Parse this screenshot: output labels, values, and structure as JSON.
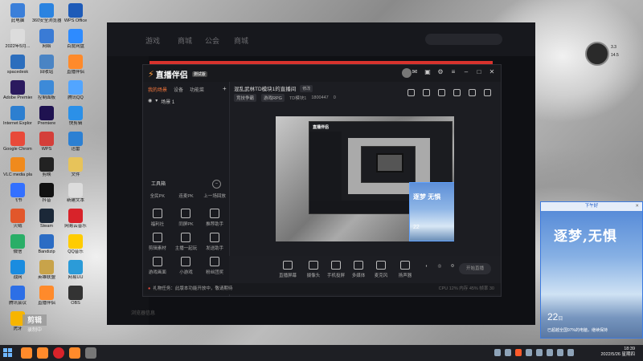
{
  "desktop": {
    "icons": [
      {
        "label": "此电脑",
        "color": "#3b7fd9"
      },
      {
        "label": "360安全浏览器",
        "color": "#2a83e0"
      },
      {
        "label": "WPS Office",
        "color": "#1e5bb8"
      },
      {
        "label": "2022年5月...",
        "color": "#dcdcdc"
      },
      {
        "label": "网络",
        "color": "#3a7bd5"
      },
      {
        "label": "百度网盘",
        "color": "#2e8bff"
      },
      {
        "label": "spacedesk",
        "color": "#2c6ebd"
      },
      {
        "label": "回收站",
        "color": "#4a84c4"
      },
      {
        "label": "直播伴侣",
        "color": "#ff8a2b"
      },
      {
        "label": "Adobe Premiere",
        "color": "#2b1a5e"
      },
      {
        "label": "控制面板",
        "color": "#3d8ad8"
      },
      {
        "label": "腾讯QQ",
        "color": "#52a5ff"
      },
      {
        "label": "Internet Explorer",
        "color": "#2d7fd0"
      },
      {
        "label": "Premiere",
        "color": "#1f1250"
      },
      {
        "label": "快剪辑",
        "color": "#2b90e8"
      },
      {
        "label": "Google Chrome",
        "color": "#e84a3a"
      },
      {
        "label": "WPS",
        "color": "#d43f3a"
      },
      {
        "label": "迅雷",
        "color": "#2c80d3"
      },
      {
        "label": "VLC media player",
        "color": "#f08a1c"
      },
      {
        "label": "剪映",
        "color": "#222"
      },
      {
        "label": "文件",
        "color": "#e7c35a"
      },
      {
        "label": "飞书",
        "color": "#3370ff"
      },
      {
        "label": "抖音",
        "color": "#111"
      },
      {
        "label": "新建文本",
        "color": "#dcdcdc"
      },
      {
        "label": "火绒",
        "color": "#e2572b"
      },
      {
        "label": "Steam",
        "color": "#1b2838"
      },
      {
        "label": "网易云音乐",
        "color": "#d8232a"
      },
      {
        "label": "微信",
        "color": "#2aae67"
      },
      {
        "label": "Bandizip",
        "color": "#2b6cc4"
      },
      {
        "label": "QQ音乐",
        "color": "#ffcc00"
      },
      {
        "label": "战网",
        "color": "#1a8ce0"
      },
      {
        "label": "英雄联盟",
        "color": "#c8a34a"
      },
      {
        "label": "网易UU",
        "color": "#2b9bd8"
      },
      {
        "label": "腾讯会议",
        "color": "#2d6fe6"
      },
      {
        "label": "直播伴侣",
        "color": "#ff8a2b"
      },
      {
        "label": "OBS",
        "color": "#333"
      },
      {
        "label": "虎牙",
        "color": "#f7b500"
      }
    ]
  },
  "bg_app": {
    "tabs": [
      "游戏",
      "商城",
      "公会",
      "商城"
    ],
    "footer": "浏览器信息"
  },
  "window": {
    "app_name": "直播伴侣",
    "app_badge": "测试版",
    "left_tabs": [
      "我的场景",
      "设备",
      "功能菜"
    ],
    "add_label": "+",
    "scene_label": "场景 1",
    "tools_title": "工具箱",
    "tool_rows": [
      [
        "全民PK",
        "连麦PK",
        "上一场回放"
      ],
      [
        "福利社",
        "同屏PK",
        "推荐助手"
      ],
      [
        "剪辑素材",
        "主播一起玩",
        "发送助手"
      ],
      [
        "游戏画面",
        "小游戏",
        "粉丝团奖"
      ]
    ],
    "room_title": "混乱武林TD模块1的直播间",
    "edit_label": "修改",
    "room_tags": [
      "竞技争霸",
      "游戏RPG",
      "TD模块1",
      "1800447",
      "0"
    ],
    "controls": [
      "直播屏幕",
      "摄像头",
      "手机投屏",
      "多媒体",
      "麦克风",
      "扬声器"
    ],
    "start_label": "开始直播",
    "notice": "礼物任务：此版本功能开放中，敬请期待",
    "stats": "CPU 12%   内存 45%   帧率 30"
  },
  "preview": {
    "title": "直播伴侣",
    "card_text": "逐梦 无惧",
    "card_day": "22"
  },
  "widget": {
    "header": "下午好",
    "calligraphy": "逐梦,无惧",
    "day": "22",
    "day_suffix": "日",
    "message": "已超越全国97%的电脑，继续保持"
  },
  "gauge": {
    "values": [
      "3.3",
      "14.5"
    ]
  },
  "taskbar": {
    "time": "18:39",
    "date": "2022/5/26 星期四",
    "overlay_badge": "剪辑",
    "overlay_badge_sub": "录制中"
  },
  "colors": {
    "accent": "#ff7a3c",
    "red_bar": "#d8332d",
    "widget_border": "#3d7be0"
  }
}
